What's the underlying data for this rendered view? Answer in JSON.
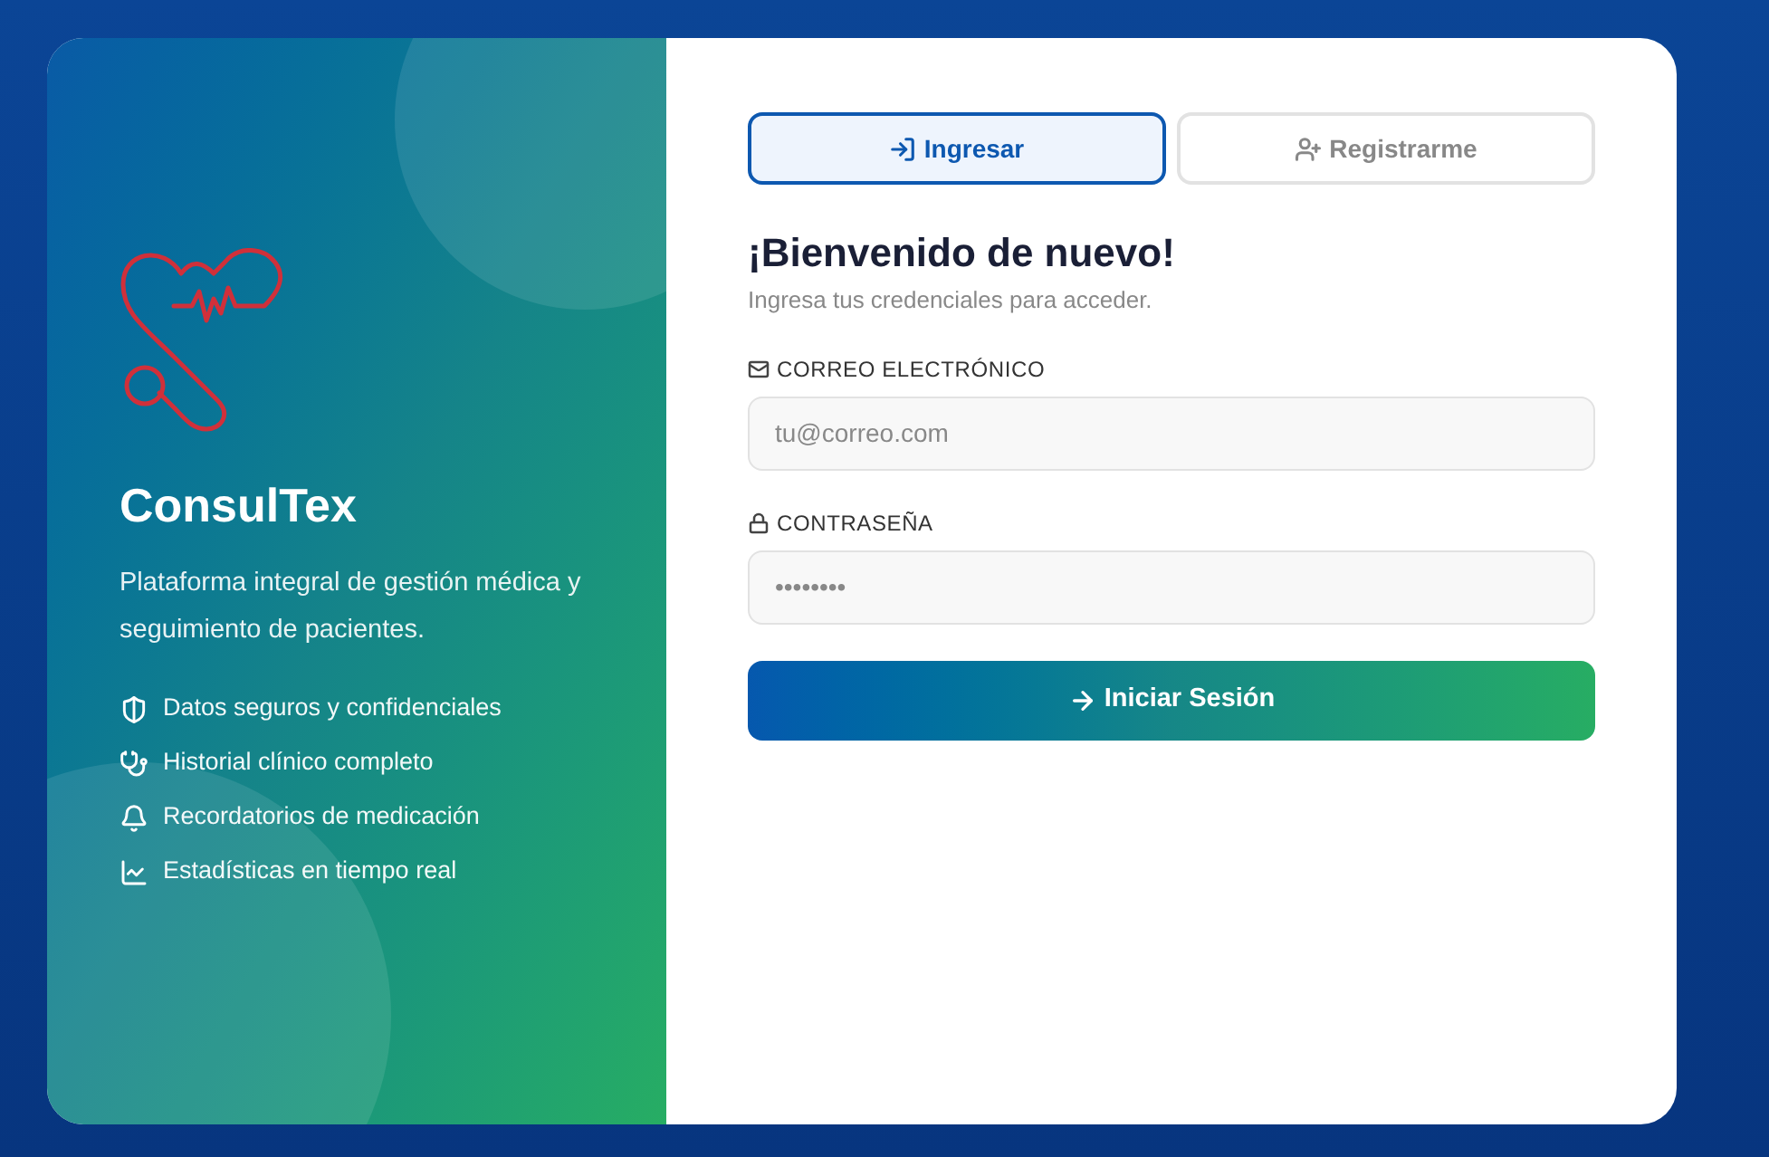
{
  "brand": {
    "name": "ConsulTex",
    "tagline": "Plataforma integral de gestión médica y seguimiento de pacientes."
  },
  "features": [
    {
      "kind": "shield",
      "label": "Datos seguros y confidenciales"
    },
    {
      "kind": "stethoscope",
      "label": "Historial clínico completo"
    },
    {
      "kind": "bell",
      "label": "Recordatorios de medicación"
    },
    {
      "kind": "chart",
      "label": "Estadísticas en tiempo real"
    }
  ],
  "tabs": [
    {
      "kind": "login",
      "label": "Ingresar",
      "selected": true
    },
    {
      "kind": "register",
      "label": "Registrarme",
      "selected": false
    }
  ],
  "form": {
    "title": "¡Bienvenido de nuevo!",
    "subtitle": "Ingresa tus credenciales para acceder.",
    "fields": [
      {
        "kind": "email",
        "label": "CORREO ELECTRÓNICO",
        "placeholder": "tu@correo.com"
      },
      {
        "kind": "password",
        "label": "CONTRASEÑA",
        "placeholder": "••••••••"
      }
    ],
    "submit": "Iniciar Sesión"
  }
}
